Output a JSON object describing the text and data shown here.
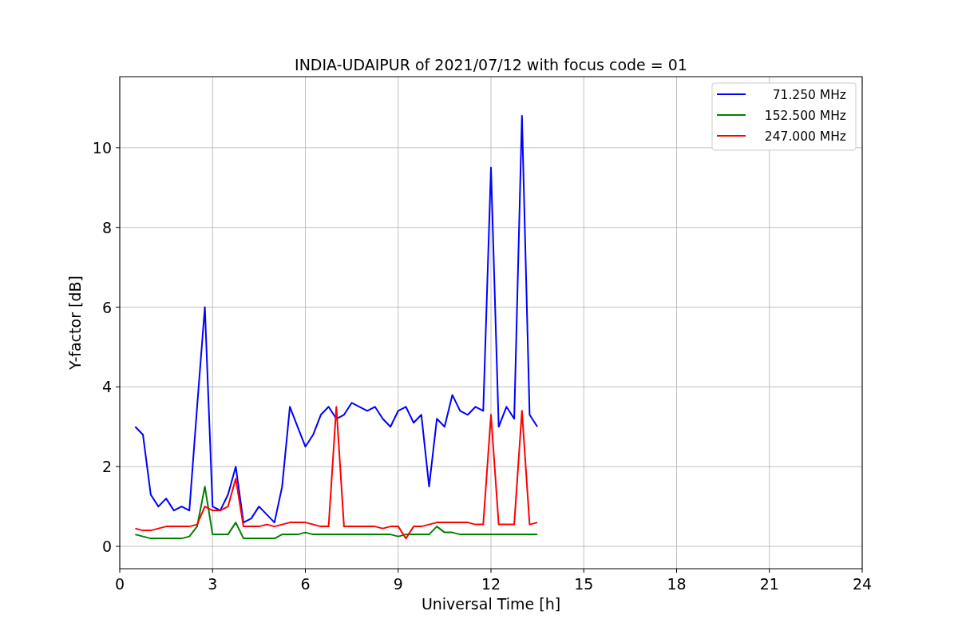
{
  "chart_data": {
    "type": "line",
    "title": "INDIA-UDAIPUR of 2021/07/12 with focus code = 01",
    "xlabel": "Universal Time [h]",
    "ylabel": "Y-factor [dB]",
    "x": [
      0.5,
      0.75,
      1,
      1.25,
      1.5,
      1.75,
      2,
      2.25,
      2.5,
      2.75,
      3,
      3.25,
      3.5,
      3.75,
      4,
      4.25,
      4.5,
      4.75,
      5,
      5.25,
      5.5,
      5.75,
      6,
      6.25,
      6.5,
      6.75,
      7,
      7.25,
      7.5,
      7.75,
      8,
      8.25,
      8.5,
      8.75,
      9,
      9.25,
      9.5,
      9.75,
      10,
      10.25,
      10.5,
      10.75,
      11,
      11.25,
      11.5,
      11.75,
      12,
      12.25,
      12.5,
      12.75,
      13,
      13.25,
      13.5
    ],
    "series": [
      {
        "name": "71.250 MHz",
        "color": "#0000ff",
        "values": [
          3.0,
          2.8,
          1.3,
          1.0,
          1.2,
          0.9,
          1.0,
          0.9,
          3.5,
          6.0,
          1.0,
          0.9,
          1.3,
          2.0,
          0.6,
          0.7,
          1.0,
          0.8,
          0.6,
          1.5,
          3.5,
          3.0,
          2.5,
          2.8,
          3.3,
          3.5,
          3.2,
          3.3,
          3.6,
          3.5,
          3.4,
          3.5,
          3.2,
          3.0,
          3.4,
          3.5,
          3.1,
          3.3,
          1.5,
          3.2,
          3.0,
          3.8,
          3.4,
          3.3,
          3.5,
          3.4,
          9.5,
          3.0,
          3.5,
          3.2,
          10.8,
          3.3,
          3.0
        ]
      },
      {
        "name": "152.500 MHz",
        "color": "#008000",
        "values": [
          0.3,
          0.25,
          0.2,
          0.2,
          0.2,
          0.2,
          0.2,
          0.25,
          0.5,
          1.5,
          0.3,
          0.3,
          0.3,
          0.6,
          0.2,
          0.2,
          0.2,
          0.2,
          0.2,
          0.3,
          0.3,
          0.3,
          0.35,
          0.3,
          0.3,
          0.3,
          0.3,
          0.3,
          0.3,
          0.3,
          0.3,
          0.3,
          0.3,
          0.3,
          0.25,
          0.3,
          0.3,
          0.3,
          0.3,
          0.5,
          0.35,
          0.35,
          0.3,
          0.3,
          0.3,
          0.3,
          0.3,
          0.3,
          0.3,
          0.3,
          0.3,
          0.3,
          0.3
        ]
      },
      {
        "name": "247.000 MHz",
        "color": "#ff0000",
        "values": [
          0.45,
          0.4,
          0.4,
          0.45,
          0.5,
          0.5,
          0.5,
          0.5,
          0.55,
          1.0,
          0.9,
          0.9,
          1.0,
          1.7,
          0.5,
          0.5,
          0.5,
          0.55,
          0.5,
          0.55,
          0.6,
          0.6,
          0.6,
          0.55,
          0.5,
          0.5,
          3.5,
          0.5,
          0.5,
          0.5,
          0.5,
          0.5,
          0.45,
          0.5,
          0.5,
          0.2,
          0.5,
          0.5,
          0.55,
          0.6,
          0.6,
          0.6,
          0.6,
          0.6,
          0.55,
          0.55,
          3.3,
          0.55,
          0.55,
          0.55,
          3.4,
          0.55,
          0.6
        ]
      }
    ],
    "xlim": [
      0,
      24
    ],
    "ylim": [
      -0.56,
      11.78
    ],
    "xticks": [
      0,
      3,
      6,
      9,
      12,
      15,
      18,
      21,
      24
    ],
    "yticks": [
      0,
      2,
      4,
      6,
      8,
      10
    ],
    "grid": true,
    "legend": true
  }
}
